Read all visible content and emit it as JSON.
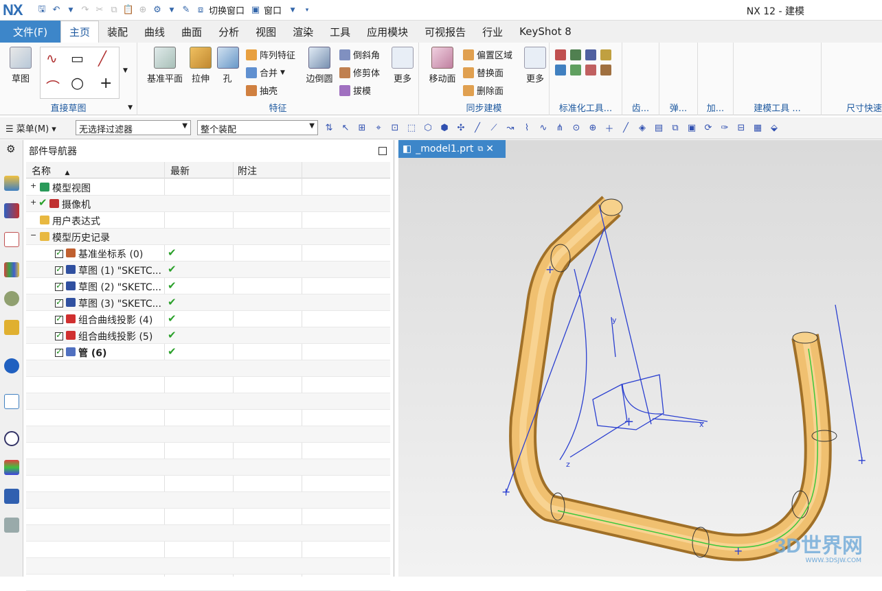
{
  "titlebar": {
    "logo": "NX",
    "switch_window": "切换窗口",
    "window_menu": "窗口",
    "title": "NX 12 - 建模"
  },
  "menubar": {
    "file": "文件(F)",
    "tabs": [
      "主页",
      "装配",
      "曲线",
      "曲面",
      "分析",
      "视图",
      "渲染",
      "工具",
      "应用模块",
      "可视报告",
      "行业",
      "KeyShot 8"
    ],
    "active_index": 0
  },
  "ribbon": {
    "sketch": "草图",
    "direct_sketch_group": "直接草图",
    "datum_plane": "基准平面",
    "extrude": "拉伸",
    "hole": "孔",
    "pattern": "阵列特征",
    "unite": "合并",
    "shell": "抽壳",
    "edge_blend": "边倒圆",
    "chamfer": "倒斜角",
    "trim_body": "修剪体",
    "draft": "拔模",
    "more": "更多",
    "feature_group": "特征",
    "move_face": "移动面",
    "offset_region": "偏置区域",
    "replace_face": "替换面",
    "delete_face": "删除面",
    "more2": "更多",
    "sync_group": "同步建模",
    "std_tools": "标准化工具...",
    "gear": "齿...",
    "spring": "弹...",
    "add": "加...",
    "modeling_tools": "建模工具 ...",
    "dimension": "尺寸快速"
  },
  "toolbar": {
    "menu": "菜单(M)",
    "filter": "无选择过滤器",
    "assembly": "整个装配"
  },
  "navigator": {
    "title": "部件导航器",
    "columns": [
      "名称",
      "最新",
      "附注"
    ],
    "rows": [
      {
        "indent": 0,
        "expander": "+",
        "icon": "model-view-icon",
        "label": "模型视图",
        "latest": "",
        "bold": false
      },
      {
        "indent": 0,
        "expander": "+",
        "icon": "camera-icon",
        "label": "摄像机",
        "latest": "",
        "bold": false
      },
      {
        "indent": 0,
        "expander": "",
        "icon": "folder-icon",
        "label": "用户表达式",
        "latest": "",
        "bold": false
      },
      {
        "indent": 0,
        "expander": "−",
        "icon": "folder-icon",
        "label": "模型历史记录",
        "latest": "",
        "bold": false
      },
      {
        "indent": 1,
        "expander": "",
        "icon": "datum-csys-icon",
        "label": "基准坐标系 (0)",
        "latest": "✔",
        "bold": false
      },
      {
        "indent": 1,
        "expander": "",
        "icon": "sketch-icon",
        "label": "草图 (1) \"SKETC...",
        "latest": "✔",
        "bold": false
      },
      {
        "indent": 1,
        "expander": "",
        "icon": "sketch-icon",
        "label": "草图 (2) \"SKETC...",
        "latest": "✔",
        "bold": false
      },
      {
        "indent": 1,
        "expander": "",
        "icon": "sketch-icon",
        "label": "草图 (3) \"SKETC...",
        "latest": "✔",
        "bold": false
      },
      {
        "indent": 1,
        "expander": "",
        "icon": "projection-icon",
        "label": "组合曲线投影 (4)",
        "latest": "✔",
        "bold": false
      },
      {
        "indent": 1,
        "expander": "",
        "icon": "projection-icon",
        "label": "组合曲线投影 (5)",
        "latest": "✔",
        "bold": false
      },
      {
        "indent": 1,
        "expander": "",
        "icon": "tube-icon",
        "label": "管 (6)",
        "latest": "✔",
        "bold": true
      }
    ]
  },
  "viewport": {
    "tab": "_model1.prt",
    "watermark": "3D世界网",
    "watermark_sub": "WWW.3DSJW.COM"
  }
}
